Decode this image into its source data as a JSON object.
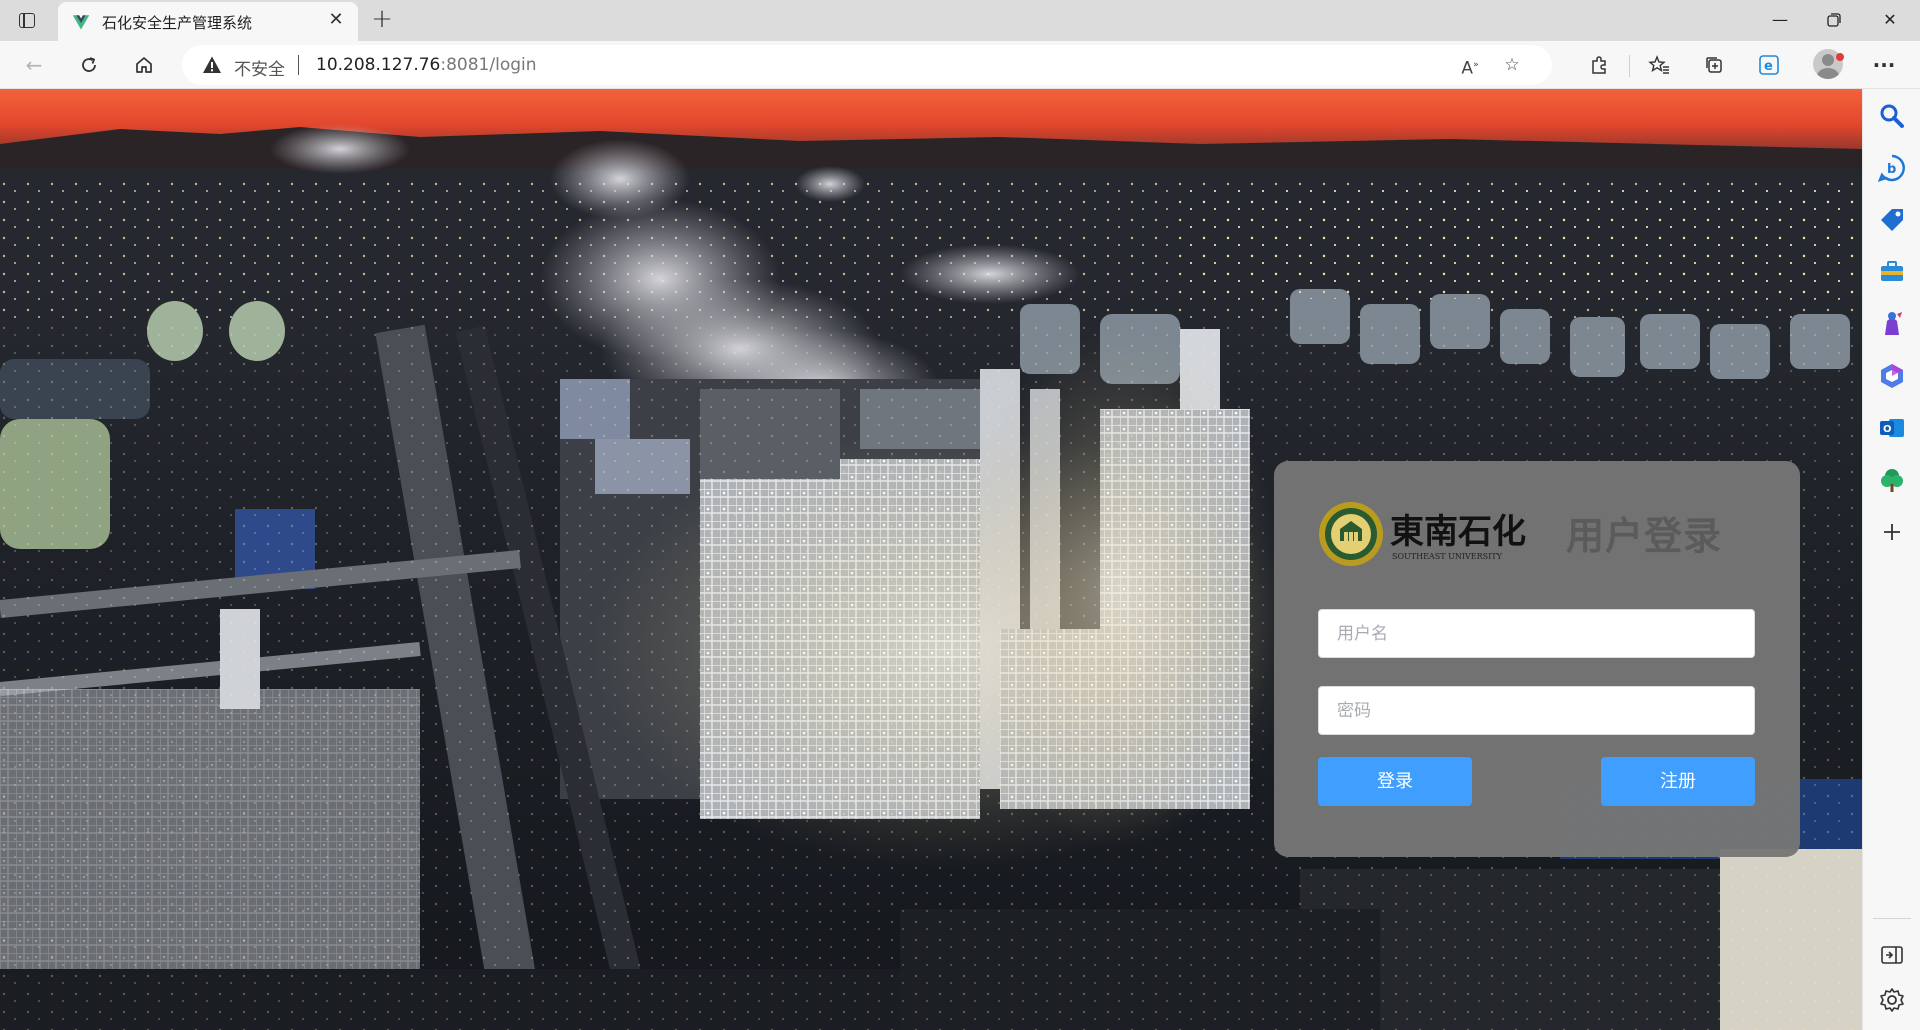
{
  "browser": {
    "tab": {
      "title": "石化安全生产管理系统",
      "favicon": "vue-logo-icon"
    },
    "address_bar": {
      "security_label": "不安全",
      "url_host": "10.208.127.76",
      "url_rest": ":8081/login"
    },
    "window_controls": [
      "minimize-icon",
      "restore-icon",
      "close-icon"
    ],
    "toolbar_icons": [
      "back-icon",
      "refresh-icon",
      "home-icon",
      "read-aloud-icon",
      "add-favorite-icon",
      "extensions-icon",
      "favorites-icon",
      "collections-icon",
      "edge-e-icon",
      "profile-avatar",
      "more-icon"
    ],
    "sidebar_icons": [
      "search-icon",
      "bing-chat-icon",
      "shopping-tag-icon",
      "tools-briefcase-icon",
      "games-icon",
      "office-icon",
      "outlook-icon",
      "tree-icon",
      "add-icon",
      "hide-sidebar-icon",
      "settings-icon"
    ]
  },
  "login": {
    "logo": {
      "brand_text": "東南石化",
      "subtitle": "SOUTHEAST UNIVERSITY"
    },
    "title": "用户登录",
    "username_placeholder": "用户名",
    "password_placeholder": "密码",
    "login_button": "登录",
    "register_button": "注册"
  },
  "colors": {
    "primary_button": "#409eff",
    "card_background": "#767676",
    "title_text": "#5b5b5b"
  }
}
